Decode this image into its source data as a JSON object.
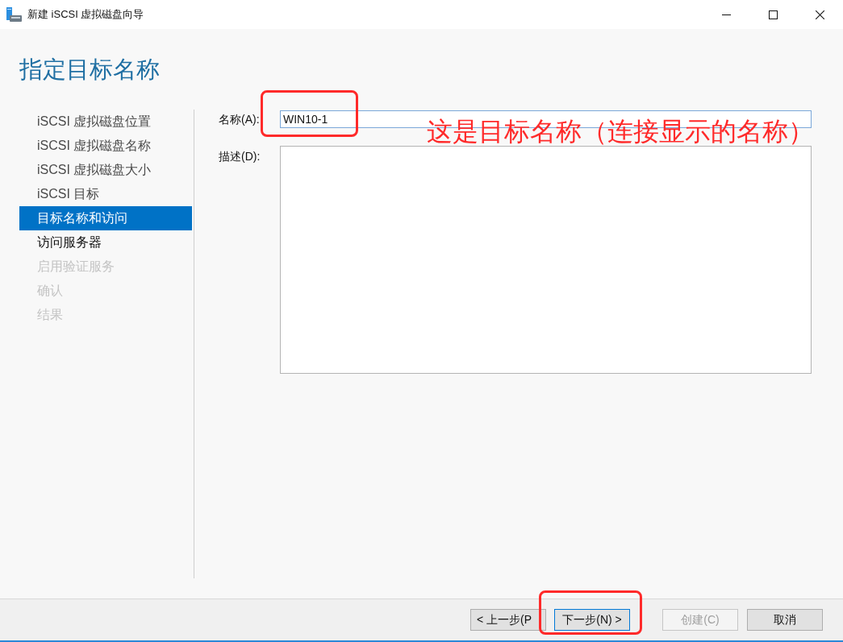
{
  "window": {
    "title": "新建 iSCSI 虚拟磁盘向导"
  },
  "heading": "指定目标名称",
  "steps": [
    {
      "label": "iSCSI 虚拟磁盘位置",
      "selected": false,
      "visited": true,
      "disabled": false
    },
    {
      "label": "iSCSI 虚拟磁盘名称",
      "selected": false,
      "visited": true,
      "disabled": false
    },
    {
      "label": "iSCSI 虚拟磁盘大小",
      "selected": false,
      "visited": true,
      "disabled": false
    },
    {
      "label": "iSCSI 目标",
      "selected": false,
      "visited": true,
      "disabled": false
    },
    {
      "label": "目标名称和访问",
      "selected": true,
      "visited": false,
      "disabled": false
    },
    {
      "label": "访问服务器",
      "selected": false,
      "visited": false,
      "disabled": false
    },
    {
      "label": "启用验证服务",
      "selected": false,
      "visited": false,
      "disabled": true
    },
    {
      "label": "确认",
      "selected": false,
      "visited": false,
      "disabled": true
    },
    {
      "label": "结果",
      "selected": false,
      "visited": false,
      "disabled": true
    }
  ],
  "form": {
    "name": {
      "label": "名称(A):",
      "value": "WIN10-1"
    },
    "description": {
      "label": "描述(D):"
    }
  },
  "buttons": [
    {
      "label": "< 上一步(P",
      "disabled": false,
      "default": false
    },
    {
      "label": "下一步(N) >",
      "disabled": false,
      "default": true
    },
    {
      "label": "创建(C)",
      "disabled": true,
      "default": false
    },
    {
      "label": "取消",
      "disabled": false,
      "default": false
    }
  ],
  "annotation": {
    "text": "这是目标名称（连接显示的名称）"
  }
}
